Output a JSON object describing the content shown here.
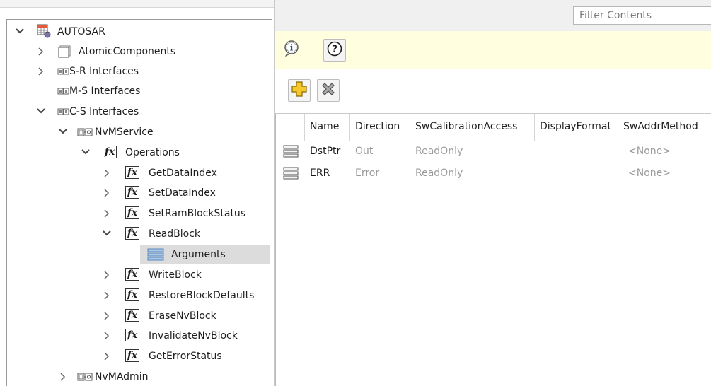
{
  "tree": {
    "root": {
      "label": "AUTOSAR",
      "icon": "autosar-grid-icon"
    },
    "items": [
      {
        "label": "AtomicComponents",
        "icon": "atomic-components-icon",
        "expanded": false
      },
      {
        "label": "S-R Interfaces",
        "icon": "sr-interface-icon",
        "expanded": false
      },
      {
        "label": "M-S Interfaces",
        "icon": "ms-interface-icon"
      },
      {
        "label": "C-S Interfaces",
        "icon": "cs-interface-icon",
        "expanded": true
      },
      {
        "label": "NvMService",
        "icon": "client-server-block-icon",
        "expanded": true
      },
      {
        "label": "Operations",
        "icon": "fx-icon",
        "expanded": true
      },
      {
        "label": "GetDataIndex",
        "icon": "fx-icon",
        "expanded": false
      },
      {
        "label": "SetDataIndex",
        "icon": "fx-icon",
        "expanded": false
      },
      {
        "label": "SetRamBlockStatus",
        "icon": "fx-icon",
        "expanded": false
      },
      {
        "label": "ReadBlock",
        "icon": "fx-icon",
        "expanded": true
      },
      {
        "label": "Arguments",
        "icon": "arguments-list-icon",
        "selected": true
      },
      {
        "label": "WriteBlock",
        "icon": "fx-icon",
        "expanded": false
      },
      {
        "label": "RestoreBlockDefaults",
        "icon": "fx-icon",
        "expanded": false
      },
      {
        "label": "EraseNvBlock",
        "icon": "fx-icon",
        "expanded": false
      },
      {
        "label": "InvalidateNvBlock",
        "icon": "fx-icon",
        "expanded": false
      },
      {
        "label": "GetErrorStatus",
        "icon": "fx-icon",
        "expanded": false
      },
      {
        "label": "NvMAdmin",
        "icon": "client-server-block-icon",
        "expanded": false
      }
    ],
    "fx_glyph": "fx",
    "interface_glyph": "ᚠᚡ",
    "block_glyph": "ᗷᕼ"
  },
  "filter": {
    "placeholder": "Filter Contents",
    "value": ""
  },
  "info": {
    "info_icon": "info-icon",
    "help_icon": "help-icon",
    "help_glyph": "?",
    "info_glyph": "i"
  },
  "toolbar": {
    "add_icon": "add-plus-icon",
    "delete_icon": "delete-x-icon"
  },
  "grid": {
    "columns": [
      "Name",
      "Direction",
      "SwCalibrationAccess",
      "DisplayFormat",
      "SwAddrMethod"
    ],
    "rows": [
      {
        "name": "DstPtr",
        "direction": "Out",
        "sw_calibration_access": "ReadOnly",
        "display_format": "",
        "sw_addr_method": "<None>"
      },
      {
        "name": "ERR",
        "direction": "Error",
        "sw_calibration_access": "ReadOnly",
        "display_format": "",
        "sw_addr_method": "<None>"
      }
    ]
  },
  "colors": {
    "info_strip": "#ffffe0",
    "selection": "#dcdcdc",
    "dim_text": "#9a9a9a",
    "add_icon": "#f2b90f",
    "delete_icon": "#8c8c8c"
  }
}
